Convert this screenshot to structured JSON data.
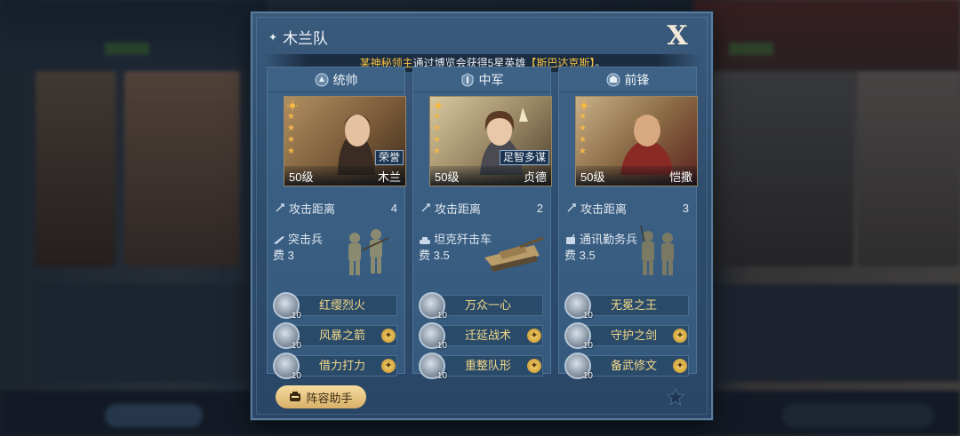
{
  "dialog": {
    "title": "木兰队",
    "close_label": "X",
    "notice": {
      "lord": "某神秘领主",
      "text": "通过博览会获得5星英雄",
      "hero": "【斯巴达克斯】",
      "end": "。"
    },
    "helper_label": "阵容助手"
  },
  "range_label": "攻击距离",
  "columns": [
    {
      "role": "统帅",
      "hero": {
        "level": "50级",
        "name": "木兰",
        "tag": "荣誉"
      },
      "range": "4",
      "troop": {
        "name": "突击兵",
        "cost": "费 3"
      },
      "skills": [
        {
          "name": "红缨烈火",
          "level": "10",
          "upgradable": false
        },
        {
          "name": "风暴之箭",
          "level": "10",
          "upgradable": true
        },
        {
          "name": "借力打力",
          "level": "10",
          "upgradable": true
        }
      ]
    },
    {
      "role": "中军",
      "hero": {
        "level": "50级",
        "name": "贞德",
        "tag": "足智多谋"
      },
      "range": "2",
      "troop": {
        "name": "坦克歼击车",
        "cost": "费 3.5"
      },
      "skills": [
        {
          "name": "万众一心",
          "level": "10",
          "upgradable": false
        },
        {
          "name": "迁延战术",
          "level": "10",
          "upgradable": true
        },
        {
          "name": "重整队形",
          "level": "10",
          "upgradable": true
        }
      ]
    },
    {
      "role": "前锋",
      "hero": {
        "level": "50级",
        "name": "恺撒",
        "tag": ""
      },
      "range": "3",
      "troop": {
        "name": "通讯勤务兵",
        "cost": "费 3.5"
      },
      "skills": [
        {
          "name": "无冕之王",
          "level": "10",
          "upgradable": false
        },
        {
          "name": "守护之剑",
          "level": "10",
          "upgradable": true
        },
        {
          "name": "备武修文",
          "level": "10",
          "upgradable": true
        }
      ]
    }
  ],
  "colors": {
    "accent_gold": "#f5c244",
    "skill_text": "#f2d888",
    "panel": "#355a7e"
  }
}
